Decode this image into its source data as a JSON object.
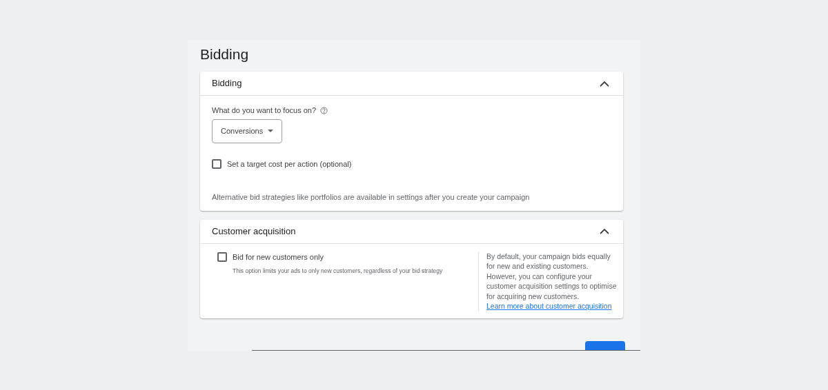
{
  "page_title": "Bidding",
  "bidding_section": {
    "title": "Bidding",
    "expanded": true,
    "focus_label": "What do you want to focus on?",
    "focus_dropdown": {
      "value": "Conversions"
    },
    "target_cpa": {
      "label": "Set a target cost per action (optional)",
      "checked": false
    },
    "note": "Alternative bid strategies like portfolios are available in settings after you create your campaign"
  },
  "customer_acquisition_section": {
    "title": "Customer acquisition",
    "expanded": true,
    "new_customers": {
      "label": "Bid for new customers only",
      "checked": false,
      "description": "This option limits your ads to only new customers, regardless of your bid strategy"
    },
    "info": "By default, your campaign bids equally for new and existing customers. However, you can configure your customer acquisition settings to optimise for acquiring new customers.",
    "info_link": "Learn more about customer acquisition"
  }
}
